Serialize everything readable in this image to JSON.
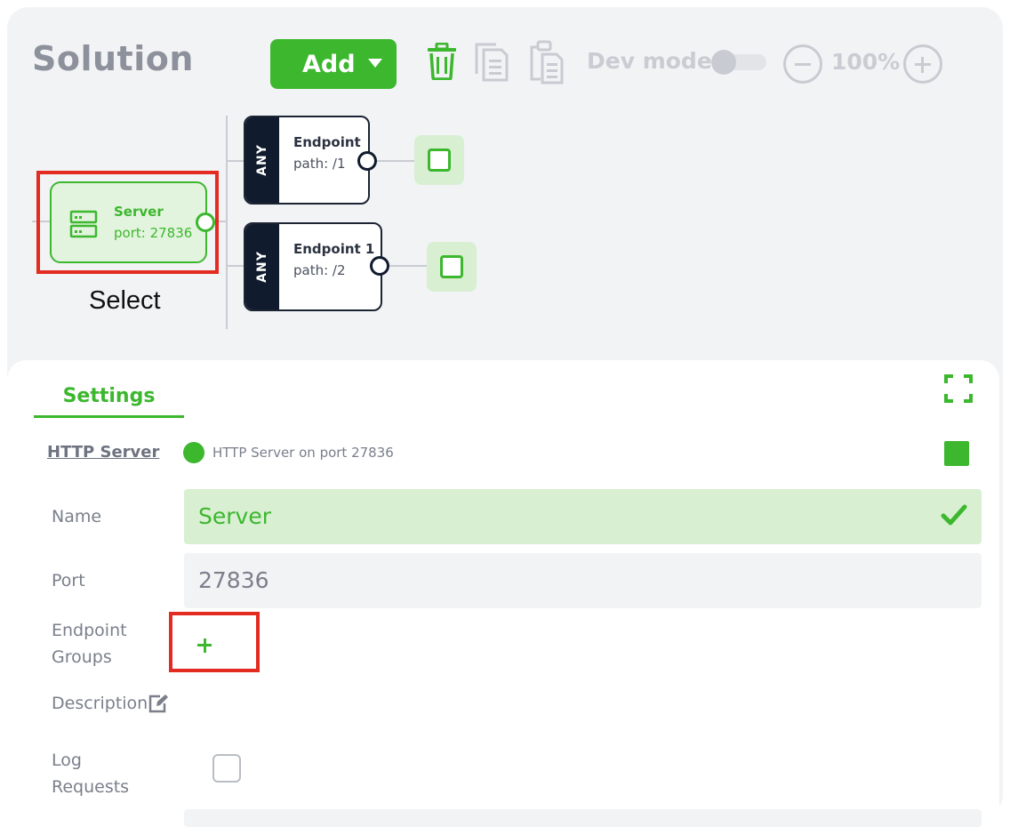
{
  "header": {
    "title": "Solution",
    "add_label": "Add",
    "dev_mode_label": "Dev mode",
    "zoom": "100%"
  },
  "diagram": {
    "server": {
      "title": "Server",
      "subtitle": "port: 27836"
    },
    "select_label": "Select",
    "endpoints": [
      {
        "method": "ANY",
        "title": "Endpoint",
        "path": "path: /1"
      },
      {
        "method": "ANY",
        "title": "Endpoint 1",
        "path": "path: /2"
      }
    ]
  },
  "panel": {
    "tab": "Settings",
    "component_link": "HTTP Server",
    "status_text": "HTTP Server on port 27836",
    "fields": {
      "name_label": "Name",
      "name_value": "Server",
      "port_label": "Port",
      "port_value": "27836",
      "endpoint_groups_line1": "Endpoint",
      "endpoint_groups_line2": "Groups",
      "add_group_label": "+",
      "description_label": "Description",
      "log_requests_line1": "Log",
      "log_requests_line2": "Requests"
    }
  },
  "colors": {
    "accent": "#3cb72e",
    "highlight": "#e32b22",
    "node_dark": "#101b2e"
  },
  "icons": [
    "trash-icon",
    "copy-icon",
    "paste-icon",
    "zoom-out-icon",
    "zoom-in-icon",
    "server-icon",
    "fullscreen-icon",
    "check-icon",
    "edit-icon"
  ]
}
